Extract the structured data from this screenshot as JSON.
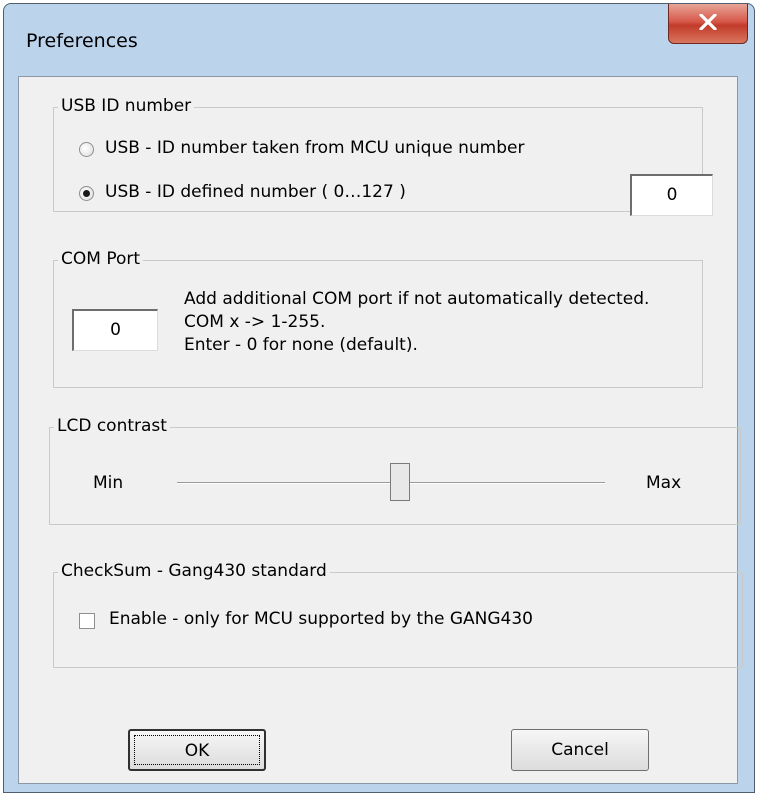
{
  "window": {
    "title": "Preferences"
  },
  "usb_group": {
    "legend": "USB ID number",
    "option_mcu": "USB - ID number taken from MCU unique number",
    "option_defined": "USB - ID defined number ( 0…127 )",
    "selected": "defined",
    "id_value": "0"
  },
  "com_group": {
    "legend": "COM Port",
    "port_value": "0",
    "help_line1": "Add additional COM port if not automatically detected.",
    "help_line2": "COM x -> 1-255.",
    "help_line3": "Enter - 0 for none (default)."
  },
  "lcd_group": {
    "legend": "LCD contrast",
    "min_label": "Min",
    "max_label": "Max",
    "level": 0.52
  },
  "checksum_group": {
    "legend": "CheckSum - Gang430 standard",
    "enable_label": "Enable - only for MCU supported by the GANG430",
    "checked": false
  },
  "buttons": {
    "ok": "OK",
    "cancel": "Cancel"
  },
  "icons": {
    "close": "close-icon"
  }
}
